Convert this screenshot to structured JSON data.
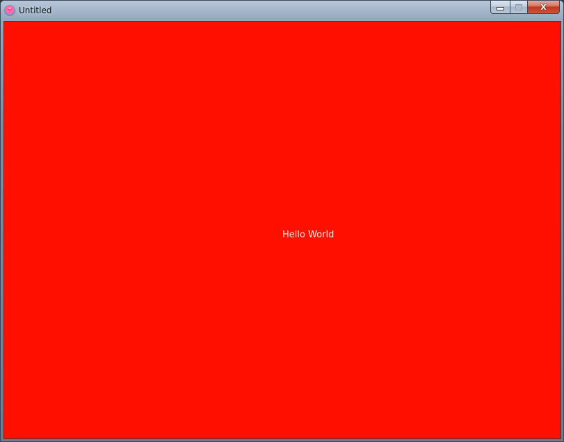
{
  "window": {
    "title": "Untitled",
    "close_glyph": "X",
    "icon": "app-heart-icon"
  },
  "content": {
    "background_color": "#ff0f00",
    "text": "Hello World",
    "text_color": "#fde8e4"
  }
}
